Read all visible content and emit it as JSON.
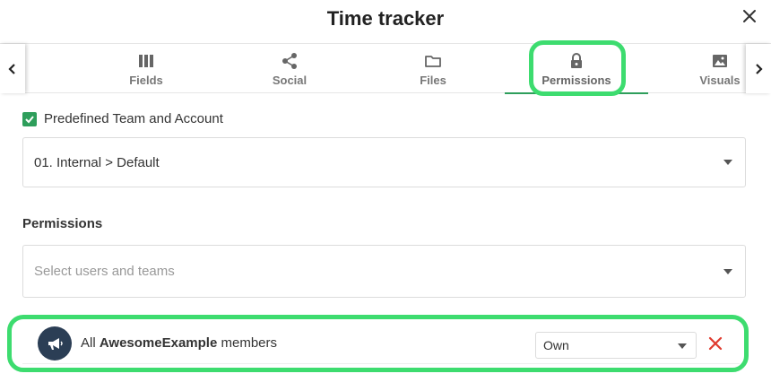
{
  "header": {
    "title": "Time tracker"
  },
  "tabs": [
    {
      "label": "Fields",
      "icon": "columns-icon"
    },
    {
      "label": "Social",
      "icon": "share-icon"
    },
    {
      "label": "Files",
      "icon": "folder-icon"
    },
    {
      "label": "Permissions",
      "icon": "lock-icon",
      "active": true
    },
    {
      "label": "Visuals",
      "icon": "image-icon"
    }
  ],
  "predefined": {
    "label": "Predefined Team and Account",
    "checked": true
  },
  "team_select": {
    "value": "01. Internal > Default"
  },
  "permissions": {
    "heading": "Permissions",
    "users_select": {
      "placeholder": "Select users and teams"
    },
    "member": {
      "prefix": "All",
      "org": "AwesomeExample",
      "suffix": "members",
      "role": "Own",
      "avatar_icon": "megaphone-icon"
    }
  },
  "colors": {
    "accent": "#2e9e5b",
    "highlight": "#3ddc6f",
    "remove": "#e03b2f",
    "avatar_bg": "#2b3e55"
  }
}
